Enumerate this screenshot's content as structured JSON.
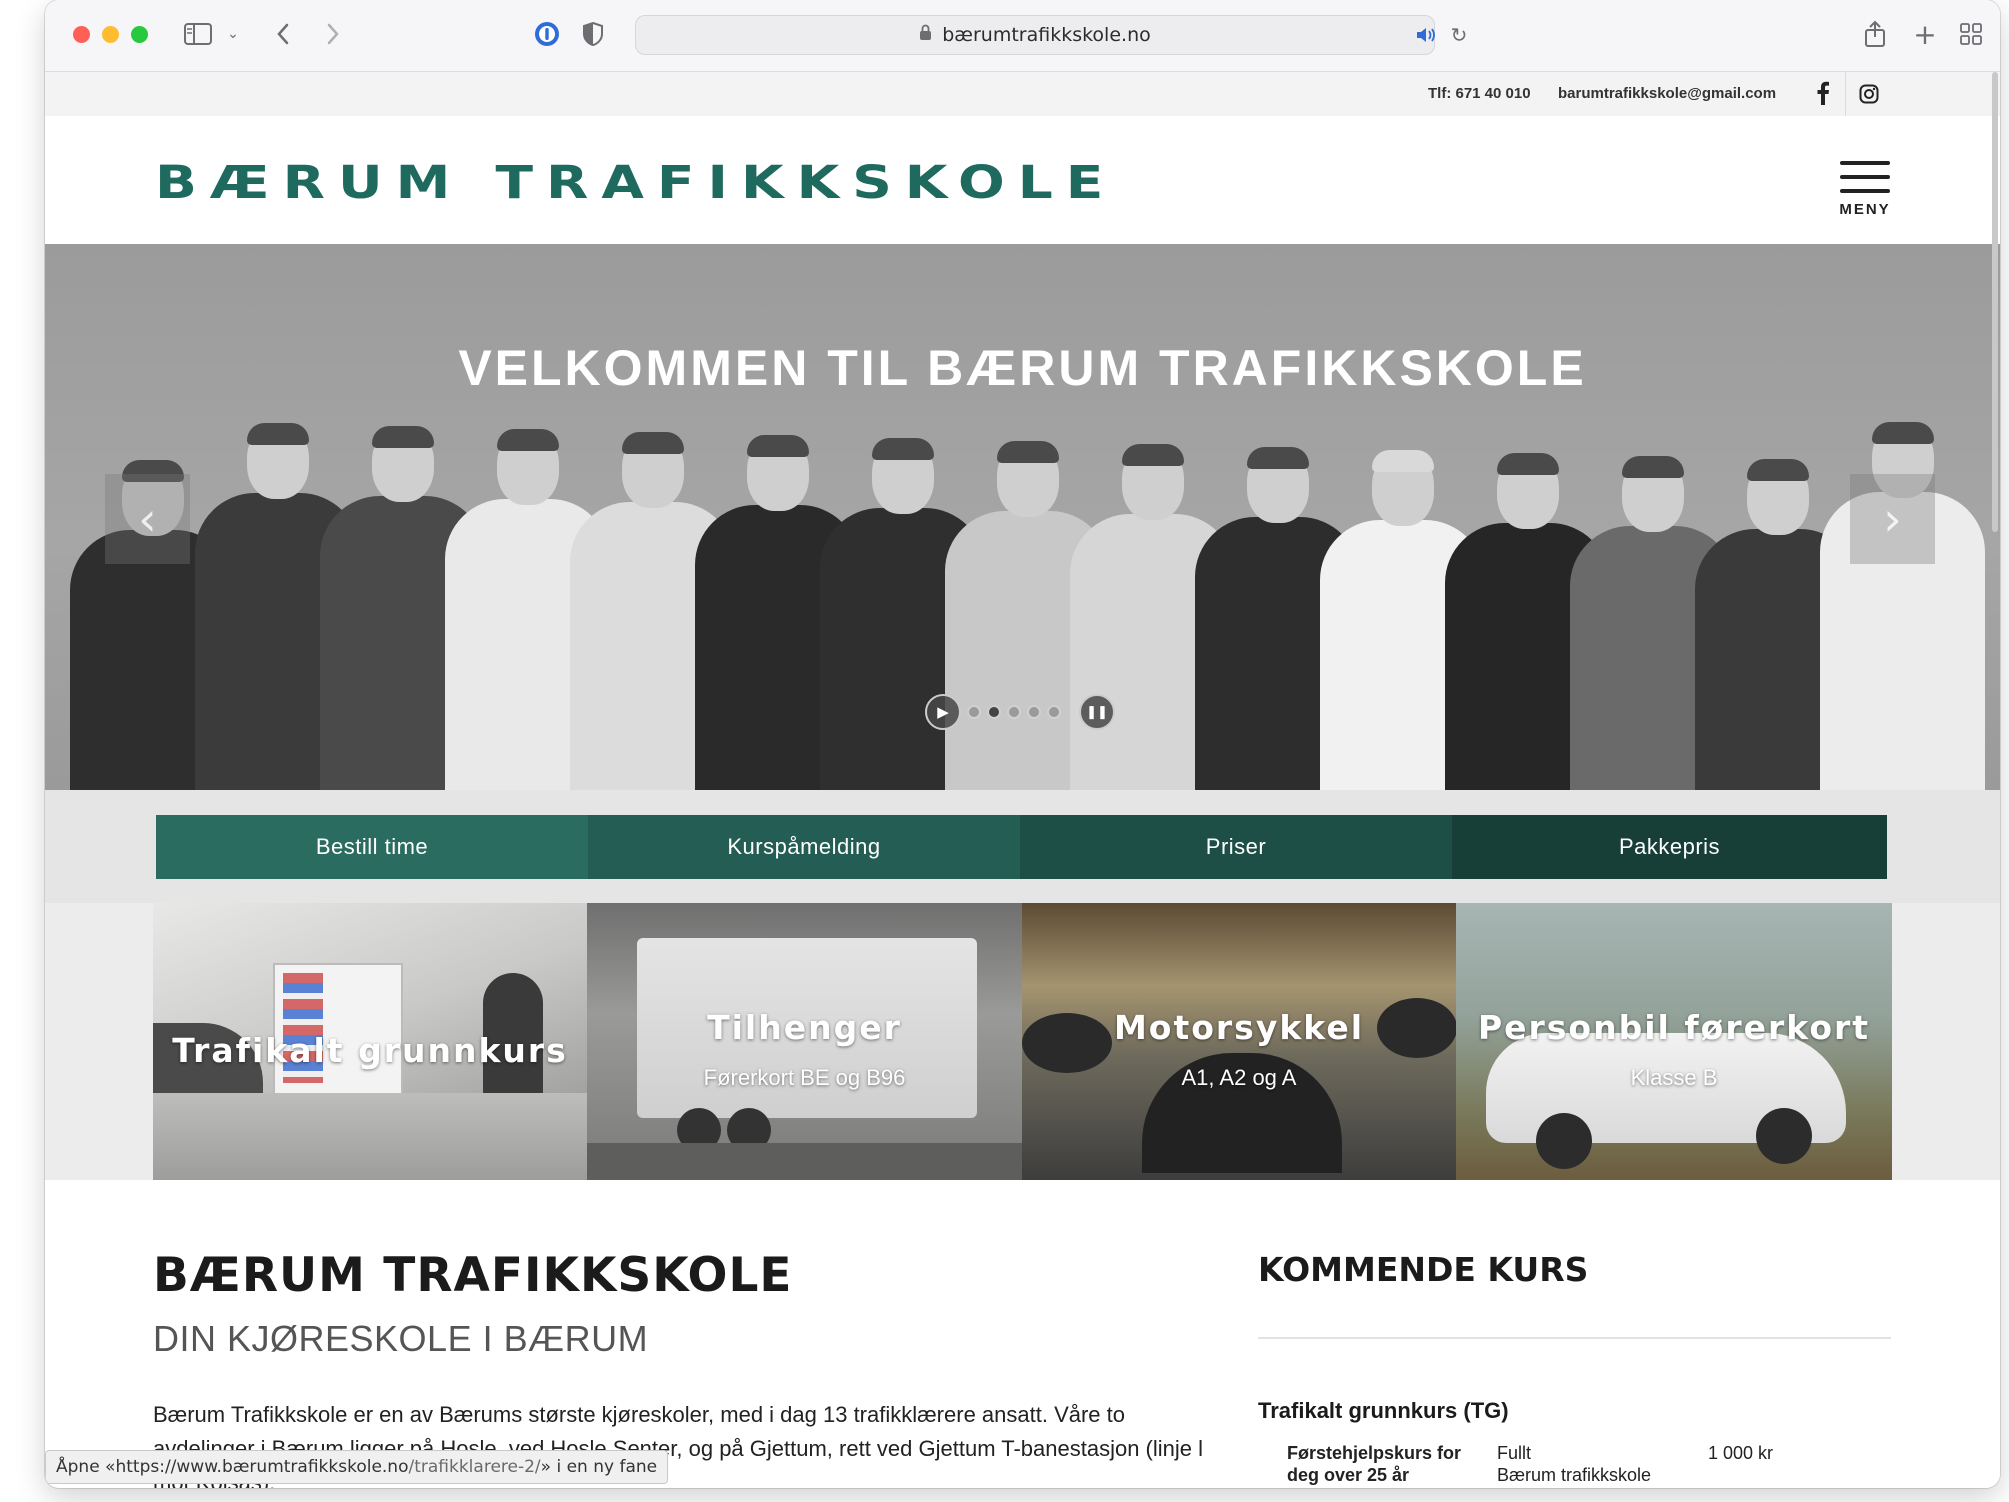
{
  "browser": {
    "url": "bærumtrafikkskole.no"
  },
  "topbar": {
    "phone": "Tlf: 671 40 010",
    "email": "barumtrafikkskole@gmail.com"
  },
  "header": {
    "logo_text": "BÆRUM TRAFIKKSKOLE",
    "menu_label": "MENY"
  },
  "hero": {
    "title": "VELKOMMEN TIL BÆRUM TRAFIKKSKOLE",
    "slides": 5,
    "active_slide": 2
  },
  "tabs": [
    {
      "label": "Bestill time",
      "color": "#2b6c61"
    },
    {
      "label": "Kurspåmelding",
      "color": "#245d53"
    },
    {
      "label": "Priser",
      "color": "#1d4f46"
    },
    {
      "label": "Pakkepris",
      "color": "#173f38"
    }
  ],
  "cards": [
    {
      "title": "Trafikalt grunnkurs",
      "subtitle": ""
    },
    {
      "title": "Tilhenger",
      "subtitle": "Førerkort BE og B96"
    },
    {
      "title": "Motorsykkel",
      "subtitle": "A1, A2 og A"
    },
    {
      "title": "Personbil førerkort",
      "subtitle": "Klasse B"
    }
  ],
  "content": {
    "title": "BÆRUM TRAFIKKSKOLE",
    "subtitle": "DIN KJØRESKOLE I BÆRUM",
    "intro": "Bærum Trafikkskole er en av Bærums største kjøreskoler, med i dag 13 trafikklærere ansatt. Våre to avdelinger i Bærum ligger på Hosle, ved Hosle Senter, og på Gjettum, rett ved Gjettum T-banestasjon (linje l mot Kolsås)."
  },
  "sidebar": {
    "title": "KOMMENDE KURS",
    "course_heading": "Trafikalt grunnkurs (TG)",
    "course_name": "Førstehjelpskurs for deg over 25 år",
    "course_status": "Fullt",
    "course_location": "Bærum trafikkskole",
    "course_price": "1 000 kr"
  },
  "statusbar": {
    "prefix": "Åpne «https://www.bærumtrafikkskole.no",
    "path": "/trafikklarere-2/",
    "suffix": "» i en ny fane"
  },
  "colors": {
    "brand": "#1f6a5e",
    "tab1": "#2b6c61",
    "tab4": "#173f38"
  }
}
